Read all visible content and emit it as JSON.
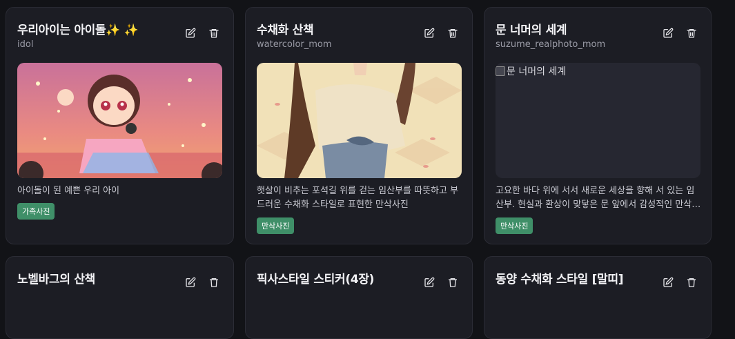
{
  "cards": [
    {
      "title": "우리아이는 아이돌✨ ✨",
      "author": "idol",
      "description": "아이돌이 된 예쁜 우리 아이",
      "tag": "가족사진",
      "image_alt": "",
      "image_kind": "idol-illustration"
    },
    {
      "title": "수채화 산책",
      "author": "watercolor_mom",
      "description": "햇살이 비추는 포석길 위를 걷는 임산부를 따뜻하고 부드러운 수채화 스타일로 표현한 만삭사진",
      "tag": "만삭사진",
      "image_alt": "",
      "image_kind": "watercolor-maternity"
    },
    {
      "title": "문 너머의 세계",
      "author": "suzume_realphoto_mom",
      "description": "고요한 바다 위에 서서 새로운 세상을 향해 서 있는 임산부. 현실과 환상이 맞닿은 문 앞에서 감성적인 만삭사진",
      "tag": "만삭사진",
      "image_alt": "문 너머의 세계",
      "image_kind": "broken"
    }
  ],
  "next_row_titles": [
    "노벨바그의 산책",
    "픽사스타일 스티커(4장)",
    "동양 수채화 스타일 [말띠]"
  ],
  "icons": {
    "edit": "pencil-square-icon",
    "delete": "trash-icon"
  },
  "colors": {
    "background": "#121317",
    "card": "#1c1d24",
    "tag": "#3f8f68"
  }
}
